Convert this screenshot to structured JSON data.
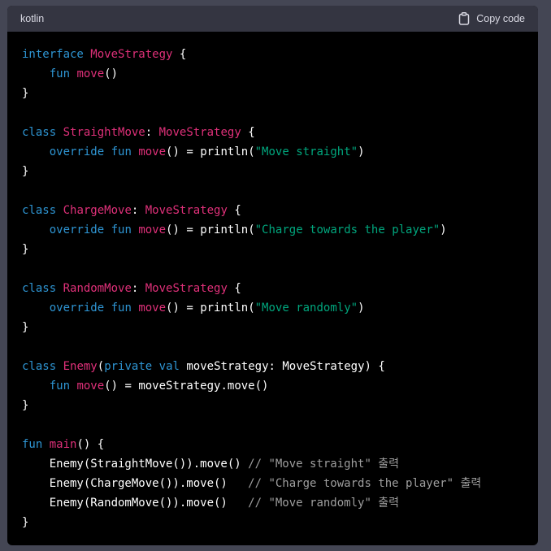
{
  "header": {
    "language": "kotlin",
    "copy_label": "Copy code",
    "copy_icon": "clipboard-icon"
  },
  "colors": {
    "background": "#444654",
    "code_background": "#000000",
    "header_background": "#343541",
    "keyword": "#2e95d3",
    "type": "#df3079",
    "string": "#00a67d",
    "comment": "#9e9e9e",
    "plain": "#ffffff"
  },
  "code": {
    "lines": [
      [
        {
          "t": "kw",
          "v": "interface"
        },
        {
          "t": "pl",
          "v": " "
        },
        {
          "t": "ty",
          "v": "MoveStrategy"
        },
        {
          "t": "pl",
          "v": " {"
        }
      ],
      [
        {
          "t": "pl",
          "v": "    "
        },
        {
          "t": "kw",
          "v": "fun"
        },
        {
          "t": "pl",
          "v": " "
        },
        {
          "t": "ty",
          "v": "move"
        },
        {
          "t": "pl",
          "v": "()"
        }
      ],
      [
        {
          "t": "pl",
          "v": "}"
        }
      ],
      [],
      [
        {
          "t": "kw",
          "v": "class"
        },
        {
          "t": "pl",
          "v": " "
        },
        {
          "t": "ty",
          "v": "StraightMove"
        },
        {
          "t": "pl",
          "v": ": "
        },
        {
          "t": "ty",
          "v": "MoveStrategy"
        },
        {
          "t": "pl",
          "v": " {"
        }
      ],
      [
        {
          "t": "pl",
          "v": "    "
        },
        {
          "t": "kw",
          "v": "override"
        },
        {
          "t": "pl",
          "v": " "
        },
        {
          "t": "kw",
          "v": "fun"
        },
        {
          "t": "pl",
          "v": " "
        },
        {
          "t": "ty",
          "v": "move"
        },
        {
          "t": "pl",
          "v": "() = println("
        },
        {
          "t": "str",
          "v": "\"Move straight\""
        },
        {
          "t": "pl",
          "v": ")"
        }
      ],
      [
        {
          "t": "pl",
          "v": "}"
        }
      ],
      [],
      [
        {
          "t": "kw",
          "v": "class"
        },
        {
          "t": "pl",
          "v": " "
        },
        {
          "t": "ty",
          "v": "ChargeMove"
        },
        {
          "t": "pl",
          "v": ": "
        },
        {
          "t": "ty",
          "v": "MoveStrategy"
        },
        {
          "t": "pl",
          "v": " {"
        }
      ],
      [
        {
          "t": "pl",
          "v": "    "
        },
        {
          "t": "kw",
          "v": "override"
        },
        {
          "t": "pl",
          "v": " "
        },
        {
          "t": "kw",
          "v": "fun"
        },
        {
          "t": "pl",
          "v": " "
        },
        {
          "t": "ty",
          "v": "move"
        },
        {
          "t": "pl",
          "v": "() = println("
        },
        {
          "t": "str",
          "v": "\"Charge towards the player\""
        },
        {
          "t": "pl",
          "v": ")"
        }
      ],
      [
        {
          "t": "pl",
          "v": "}"
        }
      ],
      [],
      [
        {
          "t": "kw",
          "v": "class"
        },
        {
          "t": "pl",
          "v": " "
        },
        {
          "t": "ty",
          "v": "RandomMove"
        },
        {
          "t": "pl",
          "v": ": "
        },
        {
          "t": "ty",
          "v": "MoveStrategy"
        },
        {
          "t": "pl",
          "v": " {"
        }
      ],
      [
        {
          "t": "pl",
          "v": "    "
        },
        {
          "t": "kw",
          "v": "override"
        },
        {
          "t": "pl",
          "v": " "
        },
        {
          "t": "kw",
          "v": "fun"
        },
        {
          "t": "pl",
          "v": " "
        },
        {
          "t": "ty",
          "v": "move"
        },
        {
          "t": "pl",
          "v": "() = println("
        },
        {
          "t": "str",
          "v": "\"Move randomly\""
        },
        {
          "t": "pl",
          "v": ")"
        }
      ],
      [
        {
          "t": "pl",
          "v": "}"
        }
      ],
      [],
      [
        {
          "t": "kw",
          "v": "class"
        },
        {
          "t": "pl",
          "v": " "
        },
        {
          "t": "ty",
          "v": "Enemy"
        },
        {
          "t": "pl",
          "v": "("
        },
        {
          "t": "kw",
          "v": "private"
        },
        {
          "t": "pl",
          "v": " "
        },
        {
          "t": "kw",
          "v": "val"
        },
        {
          "t": "pl",
          "v": " moveStrategy: MoveStrategy) {"
        }
      ],
      [
        {
          "t": "pl",
          "v": "    "
        },
        {
          "t": "kw",
          "v": "fun"
        },
        {
          "t": "pl",
          "v": " "
        },
        {
          "t": "ty",
          "v": "move"
        },
        {
          "t": "pl",
          "v": "() = moveStrategy.move()"
        }
      ],
      [
        {
          "t": "pl",
          "v": "}"
        }
      ],
      [],
      [
        {
          "t": "kw",
          "v": "fun"
        },
        {
          "t": "pl",
          "v": " "
        },
        {
          "t": "ty",
          "v": "main"
        },
        {
          "t": "pl",
          "v": "() {"
        }
      ],
      [
        {
          "t": "pl",
          "v": "    Enemy(StraightMove()).move() "
        },
        {
          "t": "cm",
          "v": "// \"Move straight\" 출력"
        }
      ],
      [
        {
          "t": "pl",
          "v": "    Enemy(ChargeMove()).move()   "
        },
        {
          "t": "cm",
          "v": "// \"Charge towards the player\" 출력"
        }
      ],
      [
        {
          "t": "pl",
          "v": "    Enemy(RandomMove()).move()   "
        },
        {
          "t": "cm",
          "v": "// \"Move randomly\" 출력"
        }
      ],
      [
        {
          "t": "pl",
          "v": "}"
        }
      ]
    ]
  }
}
